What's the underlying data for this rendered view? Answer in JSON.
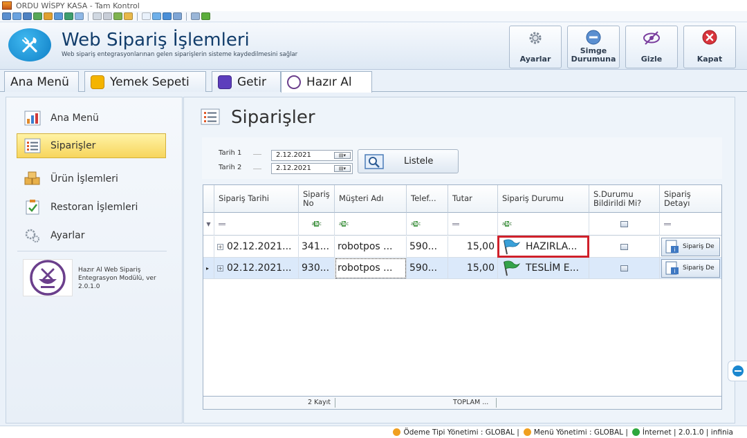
{
  "window": {
    "title": "ORDU WİSPY KASA - Tam Kontrol"
  },
  "header": {
    "title": "Web Sipariş İşlemleri",
    "subtitle": "Web sipariş entegrasyonlarınan gelen siparişlerin sisteme kaydedilmesini sağlar",
    "buttons": {
      "settings": "Ayarlar",
      "minimize_line1": "Simge",
      "minimize_line2": "Durumuna",
      "hide": "Gizle",
      "close": "Kapat"
    }
  },
  "tabs": [
    {
      "label": "Ana Menü"
    },
    {
      "label": "Yemek Sepeti"
    },
    {
      "label": "Getir"
    },
    {
      "label": "Hazır Al"
    }
  ],
  "sidebar": {
    "items": [
      {
        "label": "Ana Menü"
      },
      {
        "label": "Siparişler"
      },
      {
        "label": "Ürün İşlemleri"
      },
      {
        "label": "Restoran İşlemleri"
      },
      {
        "label": "Ayarlar"
      }
    ],
    "module_info": "Hazır Al Web Sipariş Entegrasyon Modülü, ver 2.0.1.0"
  },
  "main": {
    "title": "Siparişler",
    "filter": {
      "date1_label": "Tarih 1",
      "date1_value": "2.12.2021",
      "date2_label": "Tarih 2",
      "date2_value": "2.12.2021",
      "list_button": "Listele"
    },
    "grid": {
      "columns": [
        "Sipariş Tarihi",
        "Sipariş No",
        "Müşteri Adı",
        "Telef...",
        "Tutar",
        "Sipariş Durumu",
        "S.Durumu Bildirildi Mi?",
        "Sipariş Detayı"
      ],
      "rows": [
        {
          "date": "02.12.2021...",
          "no": "341...",
          "customer": "robotpos ...",
          "phone": "590...",
          "amount": "15,00",
          "status": "HAZIRLA...",
          "detail": "Sipariş De"
        },
        {
          "date": "02.12.2021...",
          "no": "930...",
          "customer": "robotpos ...",
          "phone": "590...",
          "amount": "15,00",
          "status": "TESLİM E...",
          "detail": "Sipariş De"
        }
      ],
      "footer": {
        "count": "2 Kayıt",
        "total": "TOPLAM ..."
      }
    }
  },
  "statusbar": {
    "payment": "Ödeme Tipi Yönetimi : GLOBAL",
    "menu": "Menü Yönetimi : GLOBAL",
    "internet": "İnternet",
    "version": "2.0.1.0",
    "brand": "infinia"
  },
  "icons": {
    "app": "app-icon",
    "header_logo": "fork-knife-icon",
    "settings": "gear-icon",
    "minimize": "minus-circle-icon",
    "hide": "eye-slash-icon",
    "close": "close-icon",
    "flag_blue": "flag-icon",
    "flag_green": "flag-icon"
  },
  "colors": {
    "accent_blue": "#1a8fd6",
    "active_nav": "#f7d55c",
    "highlight": "#d0202a",
    "close_red": "#d8343c",
    "selected_row": "#dbe9fa"
  }
}
